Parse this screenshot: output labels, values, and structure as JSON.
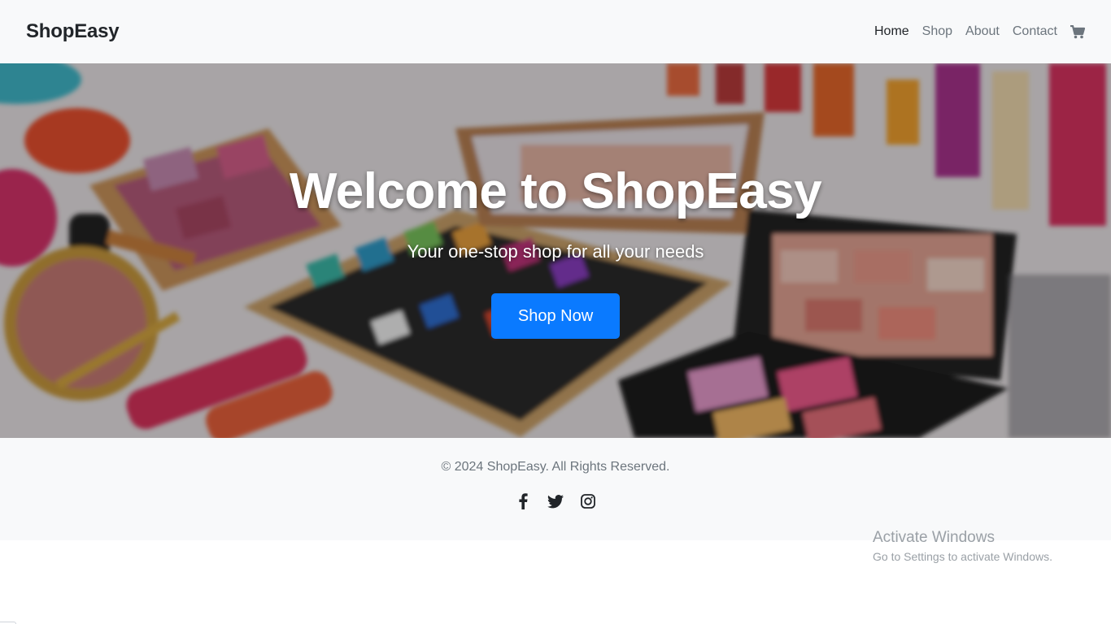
{
  "navbar": {
    "brand": "ShopEasy",
    "links": [
      {
        "label": "Home",
        "active": true
      },
      {
        "label": "Shop",
        "active": false
      },
      {
        "label": "About",
        "active": false
      },
      {
        "label": "Contact",
        "active": false
      }
    ],
    "cart_icon": "shopping-cart-icon"
  },
  "hero": {
    "title": "Welcome to ShopEasy",
    "subtitle": "Your one-stop shop for all your needs",
    "button_label": "Shop Now",
    "button_color": "#0a7aff"
  },
  "footer": {
    "copyright": "© 2024 ShopEasy. All Rights Reserved.",
    "socials": [
      "facebook-icon",
      "twitter-icon",
      "instagram-icon"
    ]
  },
  "watermark": {
    "title": "Activate Windows",
    "subtitle": "Go to Settings to activate Windows."
  }
}
